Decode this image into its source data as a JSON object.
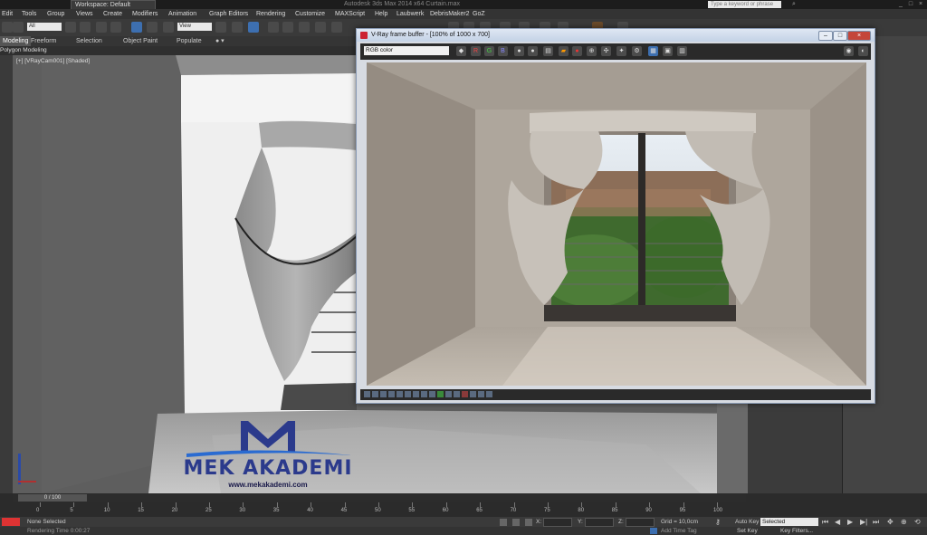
{
  "titlebar": {
    "workspace": "Workspace: Default",
    "title": "Autodesk 3ds Max 2014 x64      Curtain.max",
    "search_placeholder": "Type a keyword or phrase"
  },
  "menu": [
    "Edit",
    "Tools",
    "Group",
    "Views",
    "Create",
    "Modifiers",
    "Animation",
    "Graph Editors",
    "Rendering",
    "Customize",
    "MAXScript",
    "Help",
    "Laubwerk",
    "DebrisMaker2",
    "GoZ"
  ],
  "toolbar": {
    "selection_filter": "All",
    "ref_coord": "View"
  },
  "ribbon": {
    "tabs": [
      "Modeling",
      "Freeform",
      "Selection",
      "Object Paint",
      "Populate"
    ],
    "sub": "Polygon Modeling"
  },
  "viewport": {
    "label": "[+] [VRayCam001] [Shaded]"
  },
  "vfb": {
    "title": "V-Ray frame buffer - [100% of 1000 x 700]",
    "channel": "RGB color",
    "buttons": {
      "r": "R",
      "g": "G",
      "b": "B"
    }
  },
  "timeline": {
    "frame": "0 / 100",
    "ticks": [
      "0",
      "5",
      "10",
      "15",
      "20",
      "25",
      "30",
      "35",
      "40",
      "45",
      "50",
      "55",
      "60",
      "65",
      "70",
      "75",
      "80",
      "85",
      "90",
      "95",
      "100"
    ]
  },
  "status": {
    "selection": "None Selected",
    "render_time": "Rendering Time  0:00:27",
    "x_label": "X:",
    "y_label": "Y:",
    "z_label": "Z:",
    "grid": "Grid = 10,0cm",
    "auto_key": "Auto Key",
    "selected": "Selected",
    "set_key": "Set Key",
    "key_filters": "Key Filters...",
    "add_time_tag": "Add Time Tag"
  },
  "logo": {
    "text": "MEK AKADEMI",
    "url": "www.mekakademi.com",
    "colors": {
      "m": "#2b3a8c",
      "text": "#2b3a8c",
      "swoosh": "#2a6bd1"
    }
  }
}
